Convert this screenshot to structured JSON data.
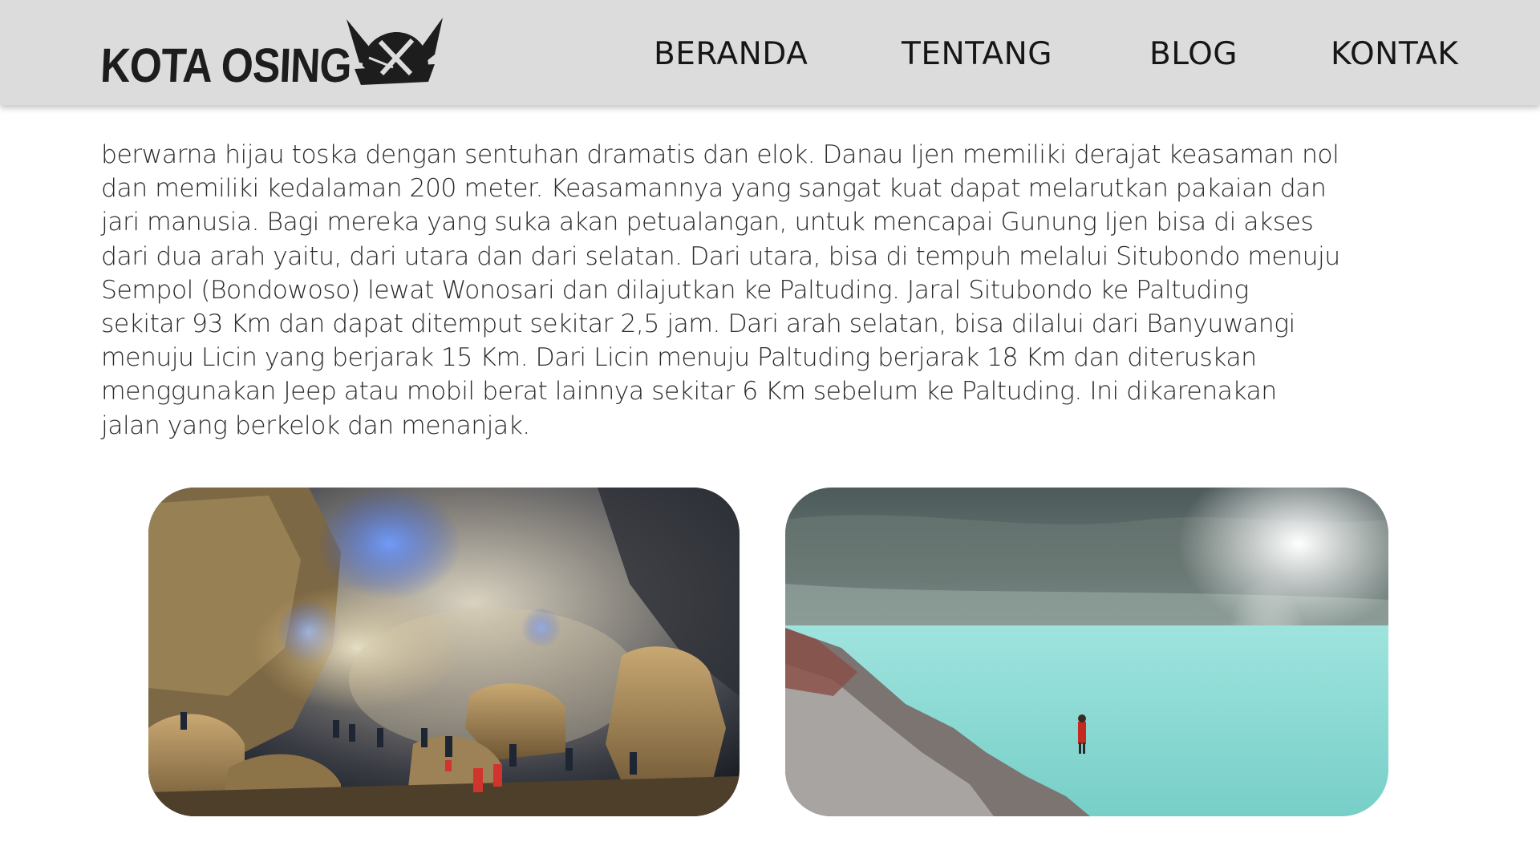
{
  "site": {
    "logo_text": "KOTA OSING"
  },
  "nav": {
    "items": [
      {
        "label": "BERANDA"
      },
      {
        "label": "TENTANG"
      },
      {
        "label": "BLOG"
      },
      {
        "label": "KONTAK"
      }
    ]
  },
  "article": {
    "lines": [
      "berwarna hijau toska dengan sentuhan dramatis dan elok. Danau Ijen memiliki derajat keasaman nol",
      "dan memiliki kedalaman 200 meter. Keasamannya yang sangat kuat dapat melarutkan pakaian dan",
      "jari manusia. Bagi mereka yang suka akan petualangan, untuk mencapai Gunung Ijen bisa di akses",
      "dari dua arah yaitu, dari utara dan dari selatan. Dari utara, bisa di tempuh melalui Situbondo menuju",
      "Sempol (Bondowoso) lewat Wonosari dan dilajutkan ke Paltuding. Jaral Situbondo ke Paltuding",
      "sekitar 93 Km dan dapat ditemput sekitar 2,5 jam. Dari arah selatan, bisa dilalui dari Banyuwangi",
      "menuju Licin yang berjarak 15 Km. Dari Licin menuju Paltuding berjarak 18 Km dan diteruskan",
      "menggunakan Jeep atau mobil berat lainnya sekitar 6 Km sebelum ke Paltuding. Ini dikarenakan",
      "jalan yang berkelok dan menanjak."
    ]
  },
  "colors": {
    "header_bg": "#dcdcdc",
    "text": "#2b2b2b",
    "lake": "#8fd8d3"
  }
}
